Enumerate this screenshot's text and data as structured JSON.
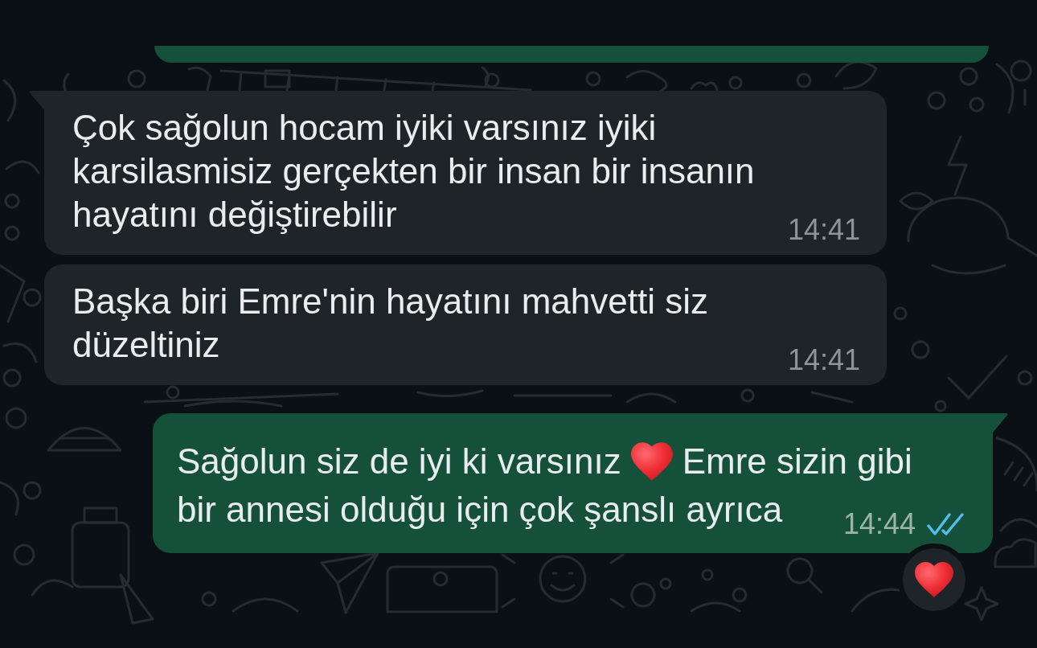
{
  "messages": [
    {
      "kind": "outgoing",
      "cropped": true
    },
    {
      "kind": "incoming",
      "cropped": false,
      "tail": true,
      "text": "Çok sağolun hocam iyiki varsınız iyiki karsilasmisiz gerçekten bir insan bir insanın hayatını değiştirebilir",
      "time": "14:41"
    },
    {
      "kind": "incoming",
      "cropped": false,
      "tail": false,
      "text": "Başka biri Emre'nin hayatını mahvetti siz düzeltiniz",
      "time": "14:41"
    },
    {
      "kind": "outgoing",
      "cropped": false,
      "tail": true,
      "lines": [
        [
          {
            "kind": "text",
            "text": "Sağolun siz de iyi ki varsınız"
          },
          {
            "kind": "heart"
          },
          {
            "kind": "text",
            "text": "Emre sizin gibi"
          }
        ],
        [
          {
            "kind": "text",
            "text": "bir annesi olduğu için çok şanslı ayrıca"
          }
        ]
      ],
      "time": "14:44",
      "read": true,
      "reaction": {
        "kind": "heart"
      }
    }
  ]
}
